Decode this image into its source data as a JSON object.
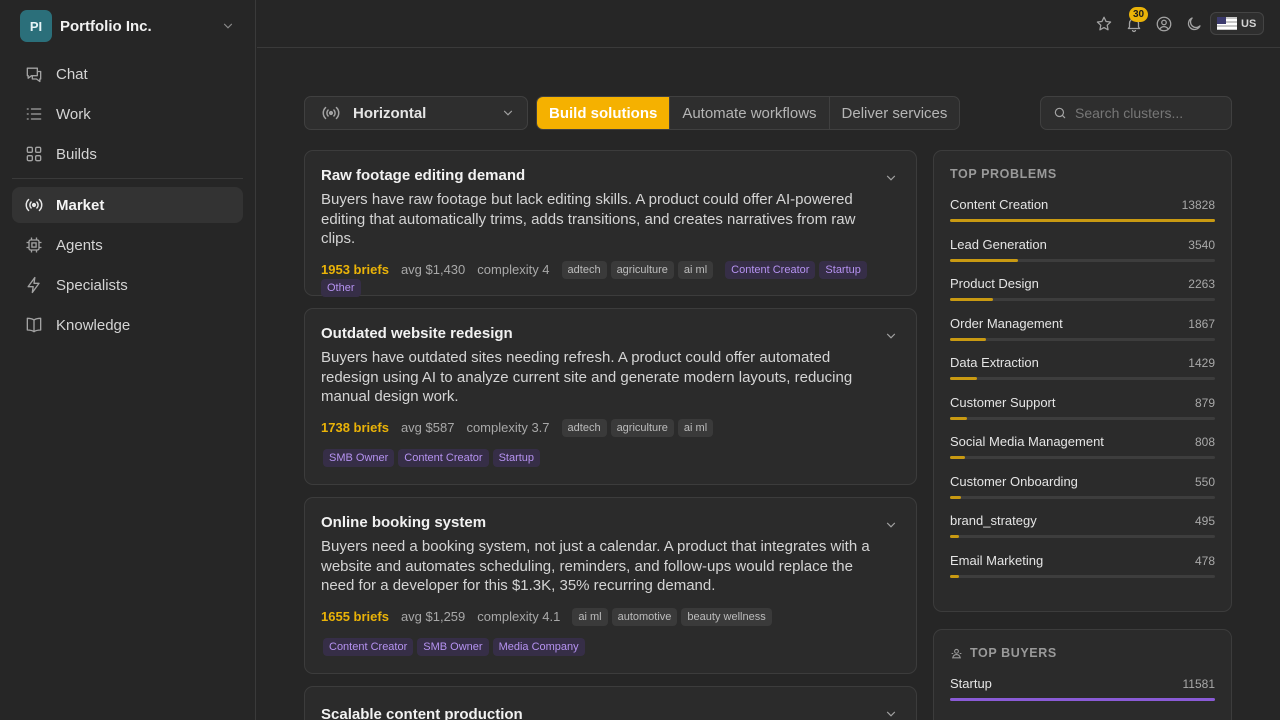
{
  "org": {
    "initials": "PI",
    "name": "Portfolio Inc."
  },
  "nav": {
    "chat": "Chat",
    "work": "Work",
    "builds": "Builds",
    "market": "Market",
    "agents": "Agents",
    "specialists": "Specialists",
    "knowledge": "Knowledge"
  },
  "topbar": {
    "notifications": "30",
    "locale": "US"
  },
  "toolbar": {
    "select_value": "Horizontal",
    "tabs": [
      "Build solutions",
      "Automate workflows",
      "Deliver services"
    ],
    "search_placeholder": "Search clusters..."
  },
  "cards": [
    {
      "title": "Raw footage editing demand",
      "desc": "Buyers have raw footage but lack editing skills. A product could offer AI-powered editing that automatically trims, adds transitions, and creates narratives from raw clips.",
      "briefs": "1953 briefs",
      "avg": "avg $1,430",
      "complexity": "complexity 4",
      "tags": [
        "adtech",
        "agriculture",
        "ai ml"
      ],
      "segments": [
        "Content Creator",
        "Startup",
        "Other"
      ]
    },
    {
      "title": "Outdated website redesign",
      "desc": "Buyers have outdated sites needing refresh. A product could offer automated redesign using AI to analyze current site and generate modern layouts, reducing manual design work.",
      "briefs": "1738 briefs",
      "avg": "avg $587",
      "complexity": "complexity 3.7",
      "tags": [
        "adtech",
        "agriculture",
        "ai ml"
      ],
      "segments": [
        "SMB Owner",
        "Content Creator",
        "Startup"
      ]
    },
    {
      "title": "Online booking system",
      "desc": "Buyers need a booking system, not just a calendar. A product that integrates with a website and automates scheduling, reminders, and follow-ups would replace the need for a developer for this $1.3K, 35% recurring demand.",
      "briefs": "1655 briefs",
      "avg": "avg $1,259",
      "complexity": "complexity 4.1",
      "tags": [
        "ai ml",
        "automotive",
        "beauty wellness"
      ],
      "segments": [
        "Content Creator",
        "SMB Owner",
        "Media Company"
      ]
    },
    {
      "title": "Scalable content production"
    }
  ],
  "top_problems": {
    "title": "TOP PROBLEMS",
    "items": [
      {
        "name": "Content Creation",
        "count": "13828",
        "value": 13828
      },
      {
        "name": "Lead Generation",
        "count": "3540",
        "value": 3540
      },
      {
        "name": "Product Design",
        "count": "2263",
        "value": 2263
      },
      {
        "name": "Order Management",
        "count": "1867",
        "value": 1867
      },
      {
        "name": "Data Extraction",
        "count": "1429",
        "value": 1429
      },
      {
        "name": "Customer Support",
        "count": "879",
        "value": 879
      },
      {
        "name": "Social Media Management",
        "count": "808",
        "value": 808
      },
      {
        "name": "Customer Onboarding",
        "count": "550",
        "value": 550
      },
      {
        "name": "brand_strategy",
        "count": "495",
        "value": 495
      },
      {
        "name": "Email Marketing",
        "count": "478",
        "value": 478
      }
    ]
  },
  "top_buyers": {
    "title": "TOP BUYERS",
    "items": [
      {
        "name": "Startup",
        "count": "11581",
        "value": 11581
      }
    ]
  },
  "colors": {
    "accent": "#f5b100",
    "bar": "#c99a12",
    "buyer_bar": "#8a5bd6",
    "segment": "#b592f0"
  }
}
